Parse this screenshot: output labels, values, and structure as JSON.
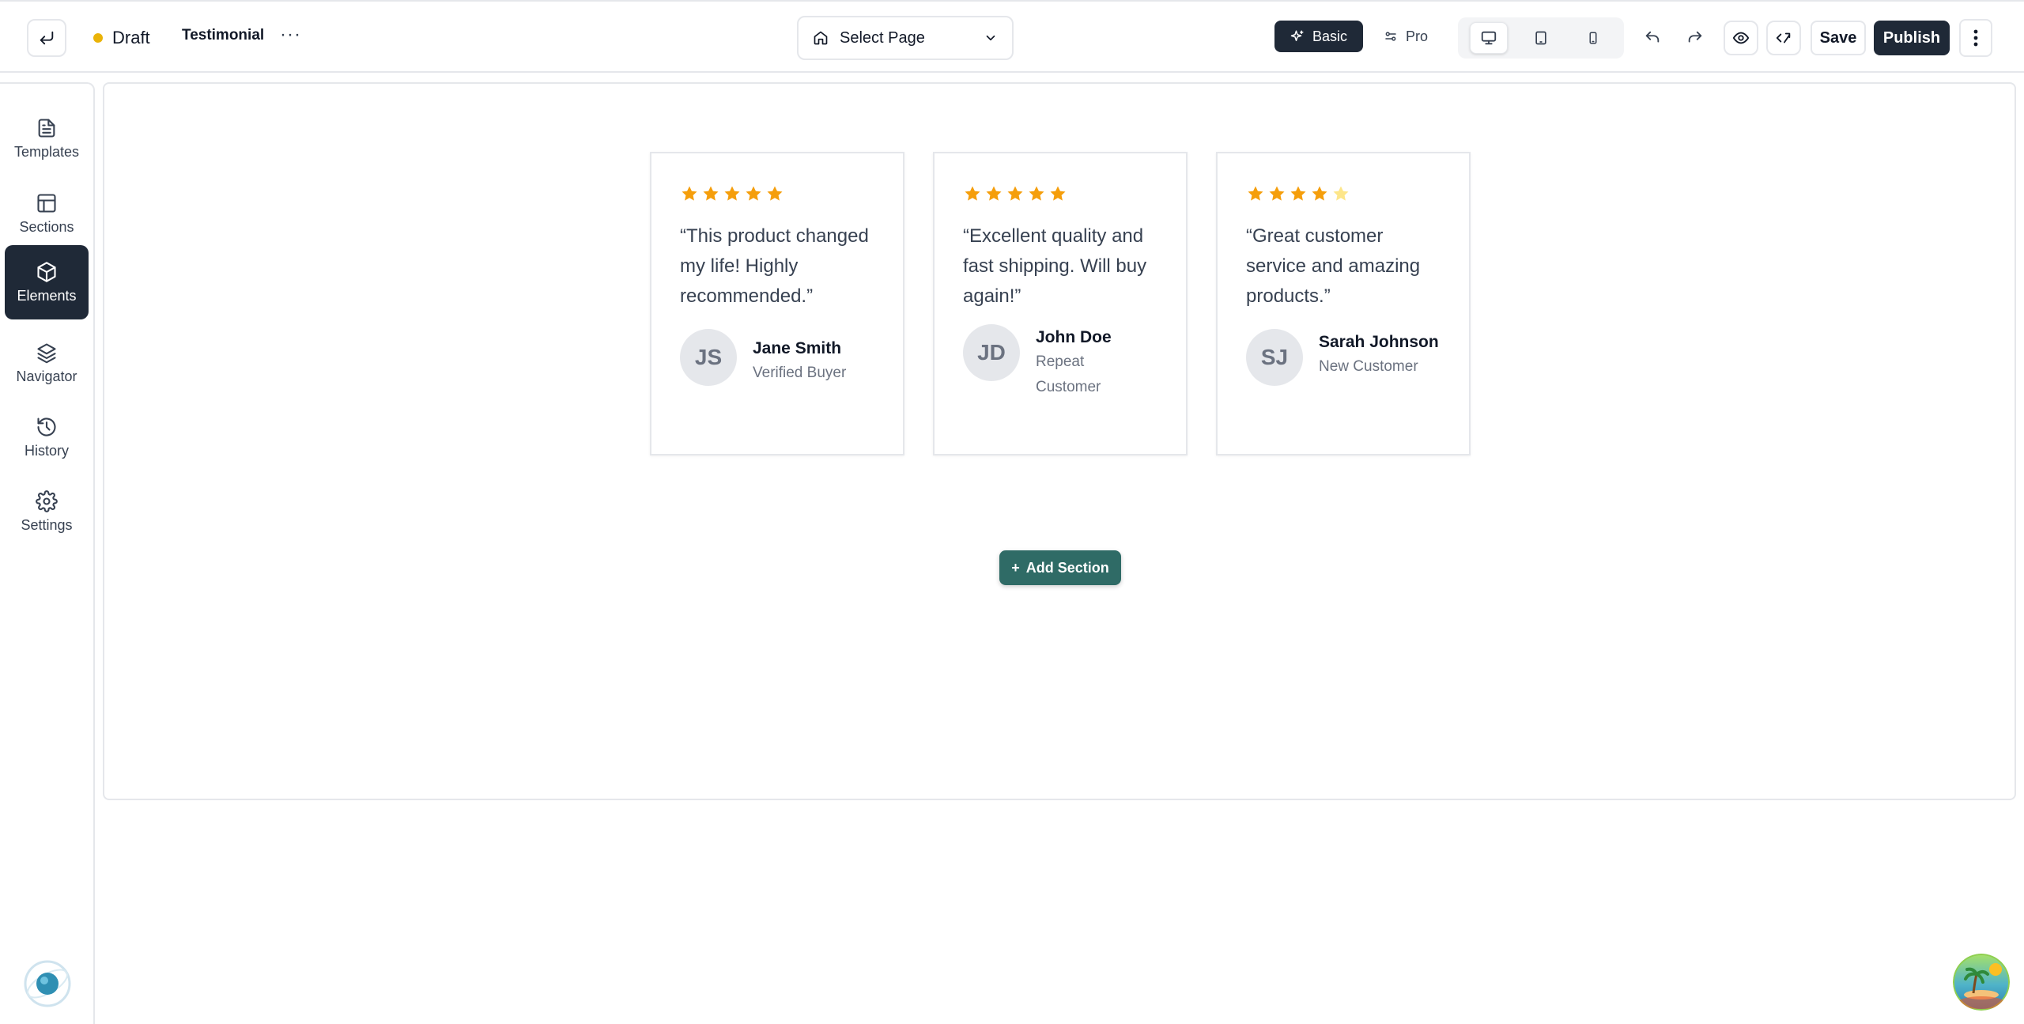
{
  "header": {
    "status": "Draft",
    "page_name": "Testimonial",
    "more_label": "···",
    "select_page": "Select Page",
    "modes": [
      {
        "label": "Basic",
        "active": true
      },
      {
        "label": "Pro",
        "active": false
      }
    ],
    "save_label": "Save",
    "publish_label": "Publish",
    "status_color": "#eab308"
  },
  "sidebar": {
    "items": [
      {
        "label": "Templates",
        "icon": "document-icon"
      },
      {
        "label": "Sections",
        "icon": "layout-icon"
      },
      {
        "label": "Elements",
        "icon": "cube-icon",
        "active": true
      },
      {
        "label": "Navigator",
        "icon": "layers-icon"
      },
      {
        "label": "History",
        "icon": "history-icon"
      },
      {
        "label": "Settings",
        "icon": "gear-icon"
      }
    ]
  },
  "testimonials": [
    {
      "rating": 5,
      "quote": "“This product changed my life! Highly recommended.”",
      "initials": "JS",
      "name": "Jane Smith",
      "role": "Verified Buyer"
    },
    {
      "rating": 5,
      "quote": "“Excellent quality and fast shipping. Will buy again!”",
      "initials": "JD",
      "name": "John Doe",
      "role": "Repeat Customer"
    },
    {
      "rating": 4,
      "quote": "“Great customer service and amazing products.”",
      "initials": "SJ",
      "name": "Sarah Johnson",
      "role": "New Customer"
    }
  ],
  "add_section_label": "Add Section",
  "colors": {
    "star": "#f59e0b",
    "star_empty": "#fde68a",
    "accent": "#2f6b66",
    "dark": "#1f2937"
  }
}
